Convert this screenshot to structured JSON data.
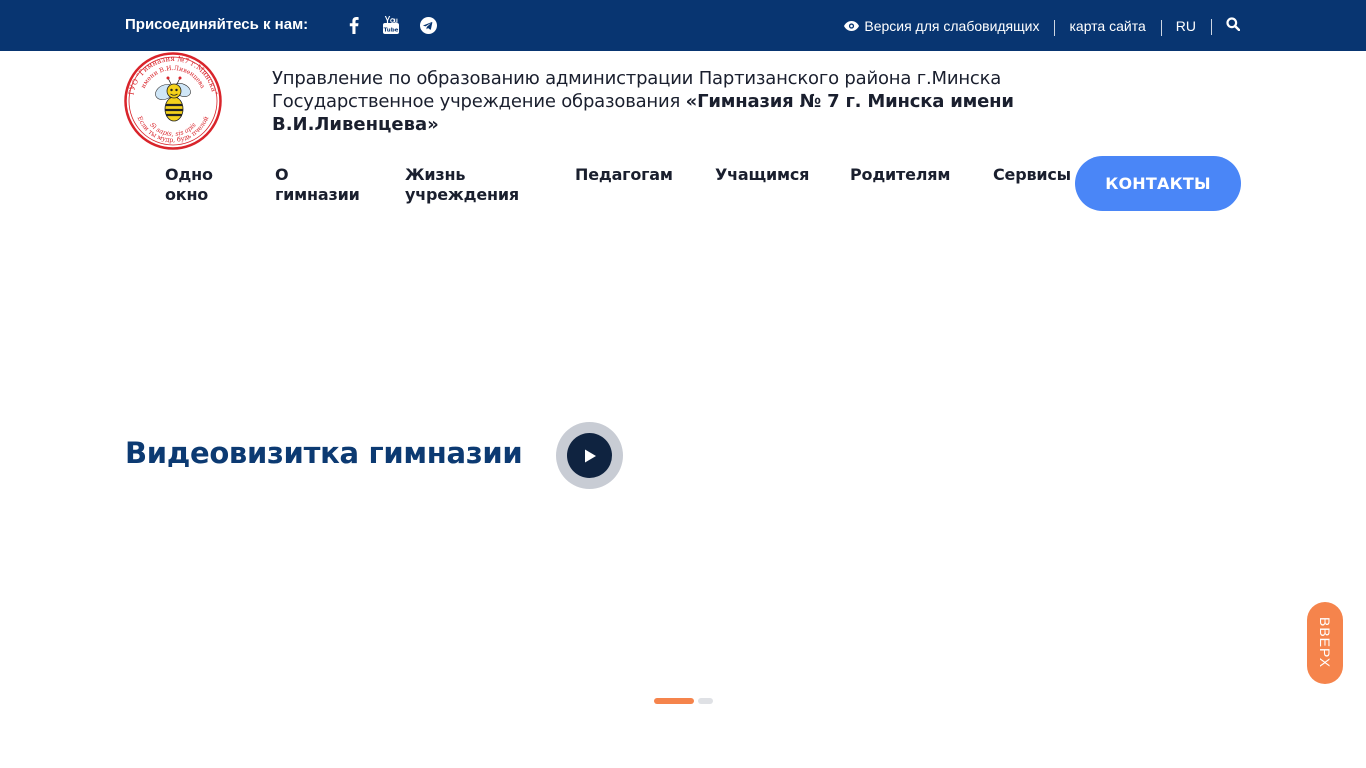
{
  "topbar": {
    "join_label": "Присоединяйтесь к нам:",
    "social": [
      {
        "icon": "facebook-icon"
      },
      {
        "icon": "youtube-icon"
      },
      {
        "icon": "telegram-icon"
      }
    ],
    "accessibility_label": "Версия для слабовидящих",
    "sitemap_label": "карта сайта",
    "language_label": "RU",
    "search_icon": "search-icon",
    "background": "#083571"
  },
  "header": {
    "org_line1": "Управление по образованию администрации Партизанского района г.Минска",
    "org_line2_prefix": "Государственное учреждение образования ",
    "org_name": "«Гимназия № 7 г. Минска имени",
    "org_name_cont": "В.И.Ливенцева»",
    "logo": {
      "ring_top_text": "ГУО \"Гимназия №7 г.Минска\"",
      "ring_inner_text": "имени В.И.Ливенцева",
      "motto_latin": "Si sapis, sis apis",
      "motto_ru": "Если ты мудр, будь пчелой"
    }
  },
  "nav": {
    "items": [
      {
        "line1": "Одно",
        "line2": "окно"
      },
      {
        "line1": "О",
        "line2": "гимназии"
      },
      {
        "line1": "Жизнь",
        "line2": "учреждения"
      },
      {
        "line1": "Педагогам",
        "line2": ""
      },
      {
        "line1": "Учащимся",
        "line2": ""
      },
      {
        "line1": "Родителям",
        "line2": ""
      },
      {
        "line1": "Сервисы",
        "line2": ""
      }
    ],
    "contacts_label": "КОНТАКТЫ",
    "contacts_color": "#4a86f7"
  },
  "hero": {
    "video_title": "Видеовизитка гимназии",
    "play_icon": "play-icon",
    "slides": {
      "count": 2,
      "active": 1,
      "active_color": "#f5844c"
    }
  },
  "scroll_top": {
    "label": "ВВЕРХ",
    "color": "#f5844c"
  }
}
